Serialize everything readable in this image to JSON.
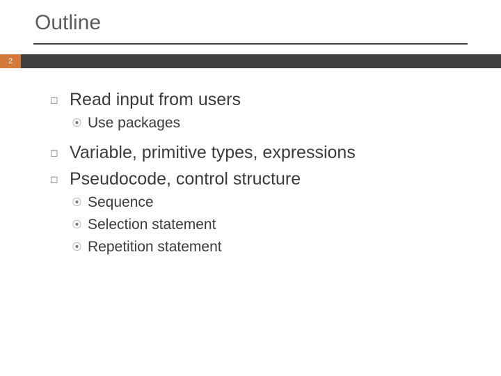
{
  "title": "Outline",
  "page_number": "2",
  "items": [
    {
      "text": "Read input from users",
      "children": [
        {
          "text": "Use packages"
        }
      ]
    },
    {
      "text": "Variable, primitive types, expressions"
    },
    {
      "text": "Pseudocode, control structure",
      "children": [
        {
          "text": "Sequence"
        },
        {
          "text": "Selection statement"
        },
        {
          "text": "Repetition statement"
        }
      ]
    }
  ]
}
